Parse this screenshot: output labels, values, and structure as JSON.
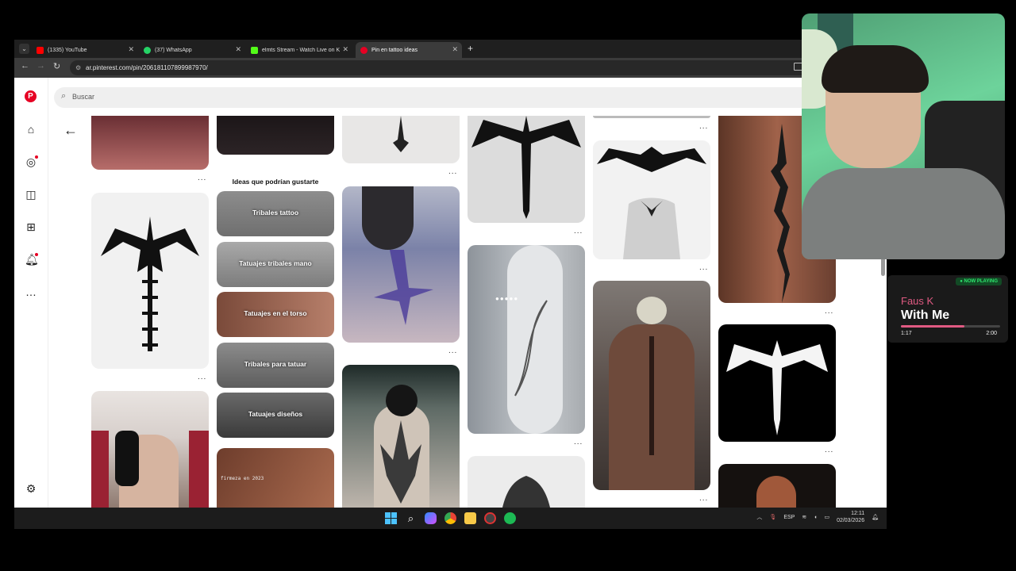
{
  "browser": {
    "tabs": [
      {
        "title": "(1335) YouTube",
        "color": "#ff0000",
        "active": false
      },
      {
        "title": "(37) WhatsApp",
        "color": "#25d366",
        "active": false
      },
      {
        "title": "elmts Stream - Watch Live on K",
        "color": "#53fc18",
        "active": false
      },
      {
        "title": "Pin en tattoo ideas",
        "color": "#e60023",
        "active": true
      }
    ],
    "new_tab": "+",
    "url": "ar.pinterest.com/pin/206181107899987970/"
  },
  "pinterest": {
    "search_placeholder": "Buscar",
    "ideas_title": "Ideas que podrían gustarte",
    "categories": [
      "Tribales tattoo",
      "Tatuajes tribales mano",
      "Tatuajes en el torso",
      "Tribales para tatuar",
      "Tatuajes diseños"
    ],
    "more_label": "...",
    "watermark_text": "firmeza en 2023"
  },
  "taskbar": {
    "language": "ESP",
    "time": "12:11",
    "date": "02/03/2026"
  },
  "now_playing": {
    "badge": "● NOW PLAYING",
    "artist": "Faus K",
    "title": "With Me",
    "elapsed": "1:17",
    "total": "2:00",
    "progress": 0.64
  }
}
